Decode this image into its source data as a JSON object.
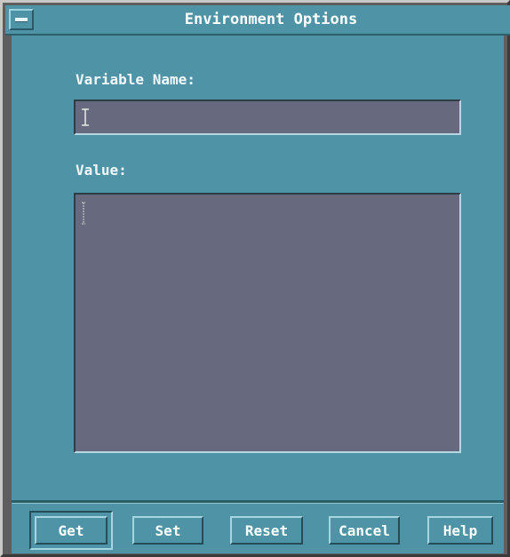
{
  "window": {
    "title": "Environment Options"
  },
  "form": {
    "variable_name_label": "Variable Name:",
    "variable_name_value": "",
    "value_label": "Value:",
    "value_value": ""
  },
  "buttons": {
    "get": "Get",
    "set": "Set",
    "reset": "Reset",
    "cancel": "Cancel",
    "help": "Help"
  },
  "icons": {
    "window_menu": "window-menu-icon",
    "text_cursor": "ibeam-cursor-icon"
  },
  "colors": {
    "frame_teal": "#4f94a6",
    "field_fill": "#676a7e",
    "text": "#ffffff"
  }
}
